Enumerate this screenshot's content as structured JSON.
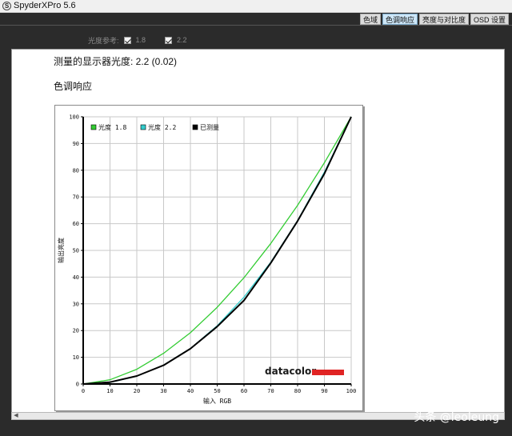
{
  "window": {
    "title": "SpyderXPro 5.6",
    "icon": "spyder-s-icon"
  },
  "tabs": [
    {
      "label": "色域",
      "active": false
    },
    {
      "label": "色调响应",
      "active": true
    },
    {
      "label": "亮度与对比度",
      "active": false
    },
    {
      "label": "OSD 设置",
      "active": false
    }
  ],
  "options": {
    "label": "光度参考:",
    "items": [
      {
        "value": "1.8",
        "checked": true
      },
      {
        "value": "2.2",
        "checked": true
      }
    ]
  },
  "report": {
    "gamma_line": "测量的显示器光度:  2.2 (0.02)",
    "section_title": "色调响应"
  },
  "chart_data": {
    "type": "line",
    "xlabel": "输入 RGB",
    "ylabel": "输出亮度",
    "xlim": [
      0,
      100
    ],
    "ylim": [
      0,
      100
    ],
    "xticks": [
      0,
      10,
      20,
      30,
      40,
      50,
      60,
      70,
      80,
      90,
      100
    ],
    "yticks": [
      0,
      10,
      20,
      30,
      40,
      50,
      60,
      70,
      80,
      90,
      100
    ],
    "grid": true,
    "legend_position": "top-left",
    "logo": "datacolor",
    "x": [
      0,
      10,
      20,
      30,
      40,
      50,
      60,
      70,
      80,
      90,
      100
    ],
    "series": [
      {
        "name": "光度 1.8",
        "color": "#33cc33",
        "values": [
          0,
          1.6,
          5.5,
          11.5,
          19.2,
          28.7,
          39.8,
          52.6,
          66.9,
          82.8,
          100
        ]
      },
      {
        "name": "光度 2.2",
        "color": "#33cccc",
        "values": [
          0,
          0.6,
          2.9,
          7.1,
          13.3,
          21.8,
          32.5,
          45.6,
          61.2,
          79.3,
          100
        ]
      },
      {
        "name": "已测量",
        "color": "#000000",
        "values": [
          0,
          0.7,
          3.0,
          7.0,
          13.2,
          21.5,
          31.3,
          45.3,
          61.0,
          78.7,
          100
        ]
      }
    ]
  },
  "watermark": "头条 @leoleung"
}
